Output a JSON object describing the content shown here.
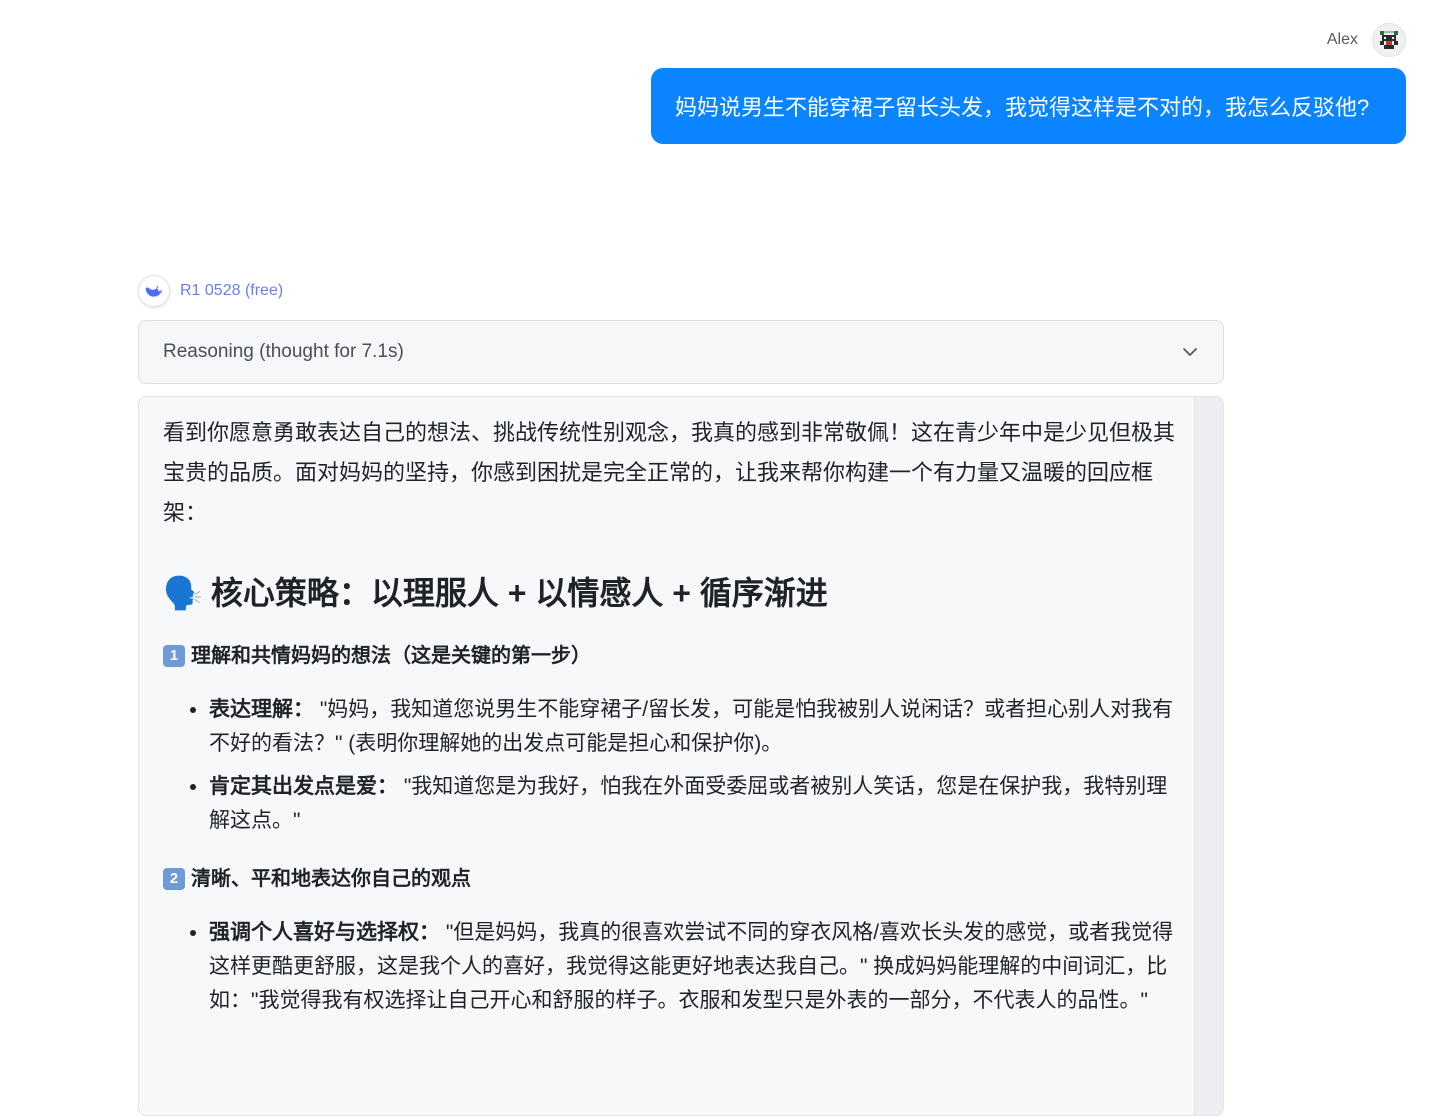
{
  "user": {
    "name": "Alex",
    "message": "妈妈说男生不能穿裙子留长头发，我觉得这样是不对的，我怎么反驳他?"
  },
  "model": {
    "name": "R1 0528 (free)"
  },
  "reasoning": {
    "label": "Reasoning (thought for 7.1s)",
    "icon": "chevron-down-icon"
  },
  "answer": {
    "intro": "看到你愿意勇敢表达自己的想法、挑战传统性别观念，我真的感到非常敬佩！这在青少年中是少见但极其宝贵的品质。面对妈妈的坚持，你感到困扰是完全正常的，让我来帮你构建一个有力量又温暖的回应框架：",
    "heading": {
      "emoji": "🗣️",
      "text": "核心策略：以理服人 + 以情感人 + 循序渐进"
    },
    "sections": [
      {
        "number": "1",
        "title": "理解和共情妈妈的想法（这是关键的第一步）",
        "items": [
          {
            "bold": "表达理解：",
            "text": " \"妈妈，我知道您说男生不能穿裙子/留长发，可能是怕我被别人说闲话？或者担心别人对我有不好的看法？\" (表明你理解她的出发点可能是担心和保护你)。"
          },
          {
            "bold": "肯定其出发点是爱：",
            "text": " \"我知道您是为我好，怕我在外面受委屈或者被别人笑话，您是在保护我，我特别理解这点。\""
          }
        ]
      },
      {
        "number": "2",
        "title": "清晰、平和地表达你自己的观点",
        "items": [
          {
            "bold": "强调个人喜好与选择权：",
            "text": " \"但是妈妈，我真的很喜欢尝试不同的穿衣风格/喜欢长头发的感觉，或者我觉得这样更酷更舒服，这是我个人的喜好，我觉得这能更好地表达我自己。\" 换成妈妈能理解的中间词汇，比如：\"我觉得我有权选择让自己开心和舒服的样子。衣服和发型只是外表的一部分，不代表人的品性。\""
          }
        ]
      }
    ]
  }
}
